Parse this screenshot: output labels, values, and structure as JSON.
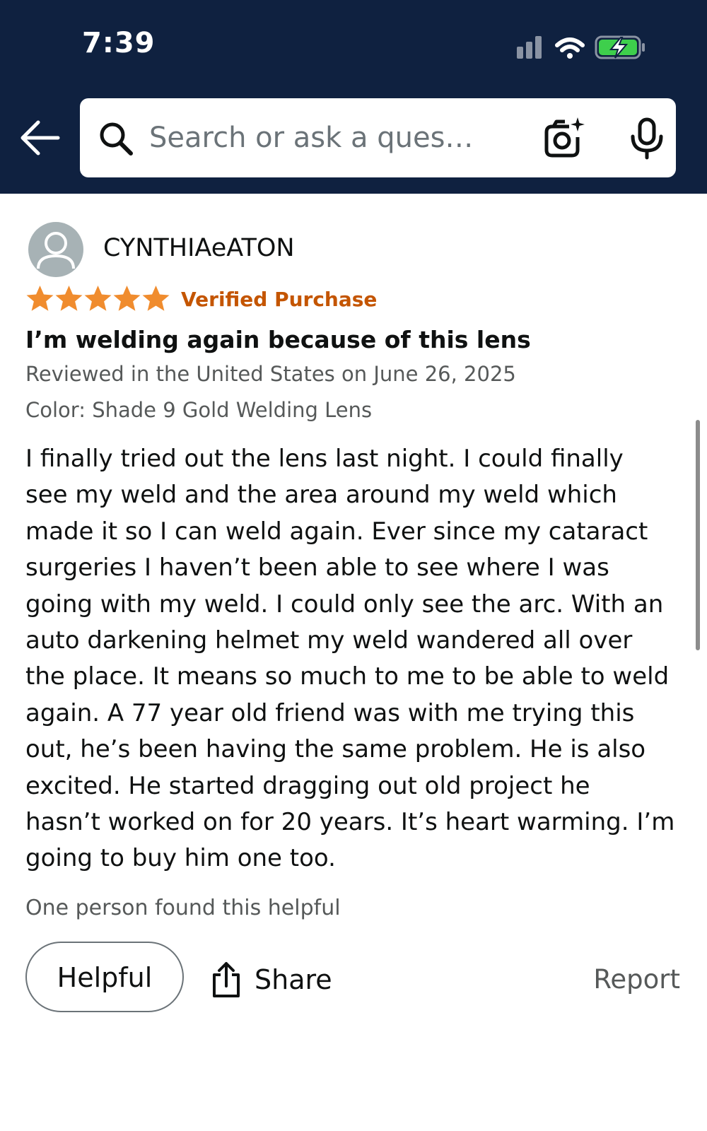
{
  "status_bar": {
    "time": "7:39",
    "icons": [
      "cellular-signal-icon",
      "wifi-icon",
      "battery-charging-icon"
    ]
  },
  "header": {
    "back_icon": "back-arrow-icon",
    "search": {
      "placeholder": "Search or ask a ques…",
      "value": ""
    },
    "camera_icon": "camera-sparkle-icon",
    "mic_icon": "microphone-icon",
    "background_color": "#0f2140"
  },
  "review": {
    "reviewer_name": "CYNTHIAeATON",
    "rating": 5,
    "rating_max": 5,
    "verified_label": "Verified Purchase",
    "title": "I’m welding again because of this lens",
    "reviewed_line": "Reviewed in the United States on June 26, 2025",
    "variant_line": "Color: Shade 9 Gold Welding Lens",
    "body_lines": [
      "I finally tried out the lens last night. I could finally",
      "see my weld and the area around my weld which",
      "made it so I can weld again. Ever since my cataract",
      "surgeries I haven’t been able to see where I was",
      "going with my weld. I could only see the arc. With an",
      "auto darkening helmet my weld wandered all over",
      "the place. It means so much to me to be able to weld",
      "again. A 77 year old friend was with me trying this",
      "out, he’s been having the same problem. He is also",
      "excited. He started dragging out old project he",
      "hasn’t worked on for 20 years. It’s heart warming. I’m",
      "going to buy him one too."
    ],
    "helpful_count_text": "One person found this helpful"
  },
  "actions": {
    "helpful_label": "Helpful",
    "share_label": "Share",
    "report_label": "Report"
  },
  "colors": {
    "star": "#f08c2e",
    "verified": "#c45500",
    "secondary_text": "#565959"
  }
}
